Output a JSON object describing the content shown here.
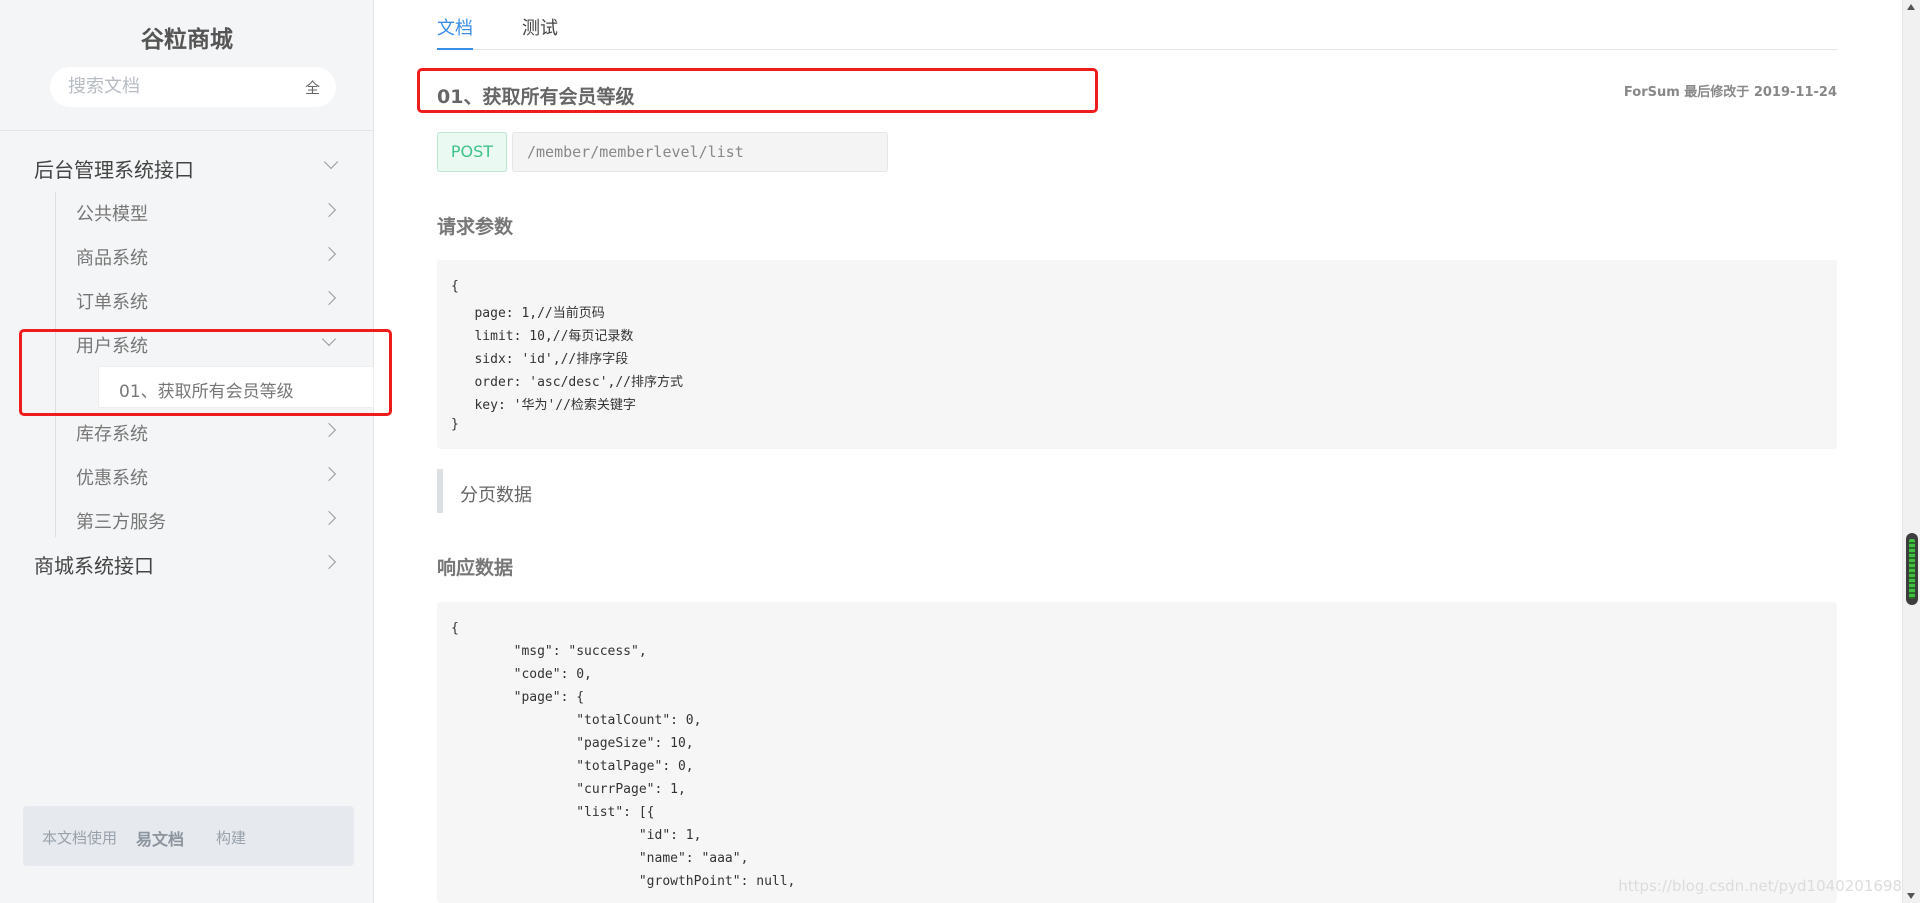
{
  "app": {
    "title": "谷粒商城"
  },
  "search": {
    "placeholder": "搜索文档",
    "scope": "全"
  },
  "sidebar": {
    "groups": [
      {
        "label": "后台管理系统接口",
        "expanded": true
      },
      {
        "label": "商城系统接口",
        "expanded": false
      }
    ],
    "items": [
      {
        "label": "公共模型"
      },
      {
        "label": "商品系统"
      },
      {
        "label": "订单系统"
      },
      {
        "label": "用户系统",
        "expanded": true
      },
      {
        "label": "库存系统"
      },
      {
        "label": "优惠系统"
      },
      {
        "label": "第三方服务"
      }
    ],
    "active_sub_item": "01、获取所有会员等级",
    "footer": {
      "prefix": "本文档使用",
      "brand": "易文档",
      "suffix": "构建"
    }
  },
  "tabs": [
    {
      "label": "文档",
      "active": true
    },
    {
      "label": "测试",
      "active": false
    }
  ],
  "doc": {
    "title": "01、获取所有会员等级",
    "meta": "ForSum 最后修改于 2019-11-24",
    "method": "POST",
    "url": "/member/memberlevel/list",
    "request_heading": "请求参数",
    "quote_text": "分页数据",
    "response_heading": "响应数据"
  },
  "request_code": [
    "{",
    "   page: 1,//当前页码",
    "   limit: 10,//每页记录数",
    "   sidx: 'id',//排序字段",
    "   order: 'asc/desc',//排序方式",
    "   key: '华为'//检索关键字",
    "}"
  ],
  "response_code": [
    "{",
    "        \"msg\": \"success\",",
    "        \"code\": 0,",
    "        \"page\": {",
    "                \"totalCount\": 0,",
    "                \"pageSize\": 10,",
    "                \"totalPage\": 0,",
    "                \"currPage\": 1,",
    "                \"list\": [{",
    "                        \"id\": 1,",
    "                        \"name\": \"aaa\",",
    "                        \"growthPoint\": null,"
  ],
  "watermark": "https://blog.csdn.net/pyd1040201698",
  "colors": {
    "accent": "#3a8ee6",
    "post_green": "#3ec28a",
    "highlight_red": "#ee1c1c"
  },
  "icons": [
    "chevron-down-icon",
    "chevron-right-icon"
  ]
}
